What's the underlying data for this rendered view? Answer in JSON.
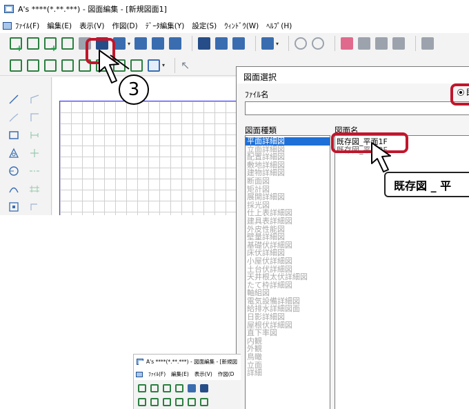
{
  "window": {
    "title": "A's ****(*.**.***) - 図面編集 - [新規図面1]",
    "menu": [
      "ﾌｧｲﾙ(F)",
      "編集(E)",
      "表示(V)",
      "作図(D)",
      "ﾃﾞｰﾀ編集(Y)",
      "設定(S)",
      "ｳｨﾝﾄﾞｳ(W)",
      "ﾍﾙﾌﾟ(H)"
    ]
  },
  "step_number": "3",
  "dialog": {
    "title": "図面選択",
    "file_label": "ﾌｧｲﾙ名",
    "file_value": "",
    "radio_label": "既",
    "category_label": "図面種類",
    "categories": [
      "平面詳細図",
      "立面詳細図",
      "配置詳細図",
      "敷地詳細図",
      "建物詳細図",
      "断面図",
      "矩計図",
      "展開詳細図",
      "採光図",
      "仕上表詳細図",
      "建具表詳細図",
      "外皮性能図",
      "壁量詳細図",
      "基礎伏詳細図",
      "床伏詳細図",
      "小屋伏詳細図",
      "土台伏詳細図",
      "天井根太伏詳細図",
      "たて枠詳細図",
      "軸組図",
      "電気設備詳細図",
      "給排水詳細図面",
      "日影詳細図",
      "屋根伏詳細図",
      "直下率図",
      "内観",
      "外観",
      "鳥瞰",
      "立面",
      "詳細"
    ],
    "selected_category": 0,
    "name_label": "図面名",
    "names": [
      "既存図_平面1F",
      "既存図_平面2F"
    ]
  },
  "tooltip": "既存図 _ 平",
  "mini_window": {
    "title": "A's ****(*.**.***) - 図面編集 - [新規図",
    "menu": [
      "ﾌｧｲﾙ(F)",
      "編集(E)",
      "表示(V)",
      "作図(D"
    ]
  },
  "colors": {
    "highlight": "#c0162c",
    "selection": "#1e6fd6",
    "grid_border": "#3b3bff"
  }
}
